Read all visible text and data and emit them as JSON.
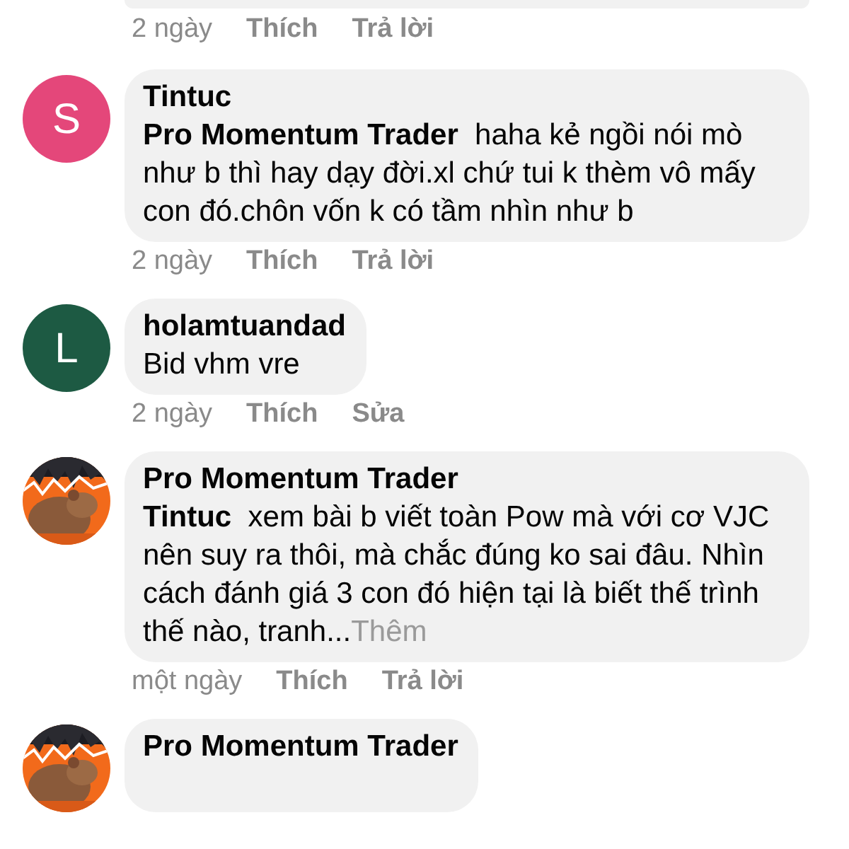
{
  "previous_comment": {
    "actions": {
      "time": "2 ngày",
      "like": "Thích",
      "reply": "Trả lời"
    }
  },
  "comments": [
    {
      "avatar": {
        "kind": "letter",
        "letter": "S",
        "color": "#e4477a"
      },
      "author": "Tintuc",
      "reply_to": "Pro Momentum Trader",
      "text": "haha kẻ ngồi nói mò như b thì hay dạy đời.xl chứ tui k thèm vô mấy con đó.chôn vốn k có tầm nhìn như b",
      "actions": {
        "time": "2 ngày",
        "like": "Thích",
        "reply": "Trả lời"
      }
    },
    {
      "avatar": {
        "kind": "letter",
        "letter": "L",
        "color": "#1d5a43"
      },
      "author": "holamtuandad",
      "text": "Bid vhm vre",
      "actions": {
        "time": "2 ngày",
        "like": "Thích",
        "reply": "Sửa"
      }
    },
    {
      "author": "Pro Momentum Trader",
      "reply_to": "Tintuc",
      "text": "xem bài b viết toàn Pow mà với cơ VJC nên suy ra thôi, mà chắc đúng ko sai đâu. Nhìn cách đánh giá 3 con đó hiện tại là biết thế trình thế nào, tranh...",
      "see_more": "Thêm",
      "actions": {
        "time": "một ngày",
        "like": "Thích",
        "reply": "Trả lời"
      }
    },
    {
      "author": "Pro Momentum Trader"
    }
  ]
}
